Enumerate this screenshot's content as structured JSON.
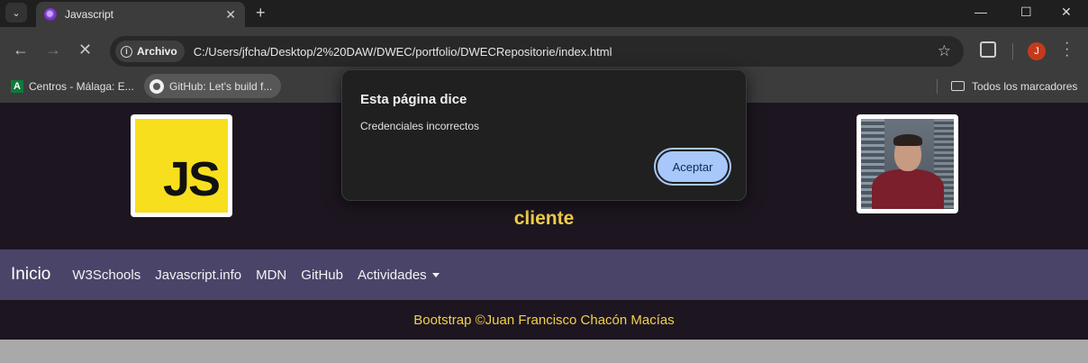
{
  "browser": {
    "tab": {
      "title": "Javascript",
      "close": "✕"
    },
    "new_tab": "+",
    "window_controls": {
      "minimize": "—",
      "maximize": "☐",
      "close": "✕"
    },
    "nav": {
      "back": "←",
      "forward": "→",
      "stop": "✕"
    },
    "address": {
      "chip_label": "Archivo",
      "url": "C:/Users/jfcha/Desktop/2%20DAW/DWEC/portfolio/DWECRepositorie/index.html"
    },
    "profile_initial": "J",
    "bookmarks": [
      {
        "label": "Centros - Málaga: E...",
        "icon": "a-logo-icon"
      },
      {
        "label": "GitHub: Let's build f...",
        "icon": "github-icon"
      }
    ],
    "all_bookmarks": "Todos los marcadores"
  },
  "page": {
    "js_logo_text": "JS",
    "subtitle": "cliente",
    "navbar": {
      "brand": "Inicio",
      "links": [
        "W3Schools",
        "Javascript.info",
        "MDN",
        "GitHub"
      ],
      "dropdown": "Actividades"
    },
    "footer": "Bootstrap ©Juan Francisco Chacón Macías"
  },
  "dialog": {
    "title": "Esta página dice",
    "message": "Credenciales incorrectos",
    "button": "Aceptar"
  },
  "colors": {
    "header_bg": "#1d1620",
    "navbar_bg": "#4b4469",
    "accent_yellow": "#f3d04a",
    "dialog_button": "#a8c7fa"
  }
}
